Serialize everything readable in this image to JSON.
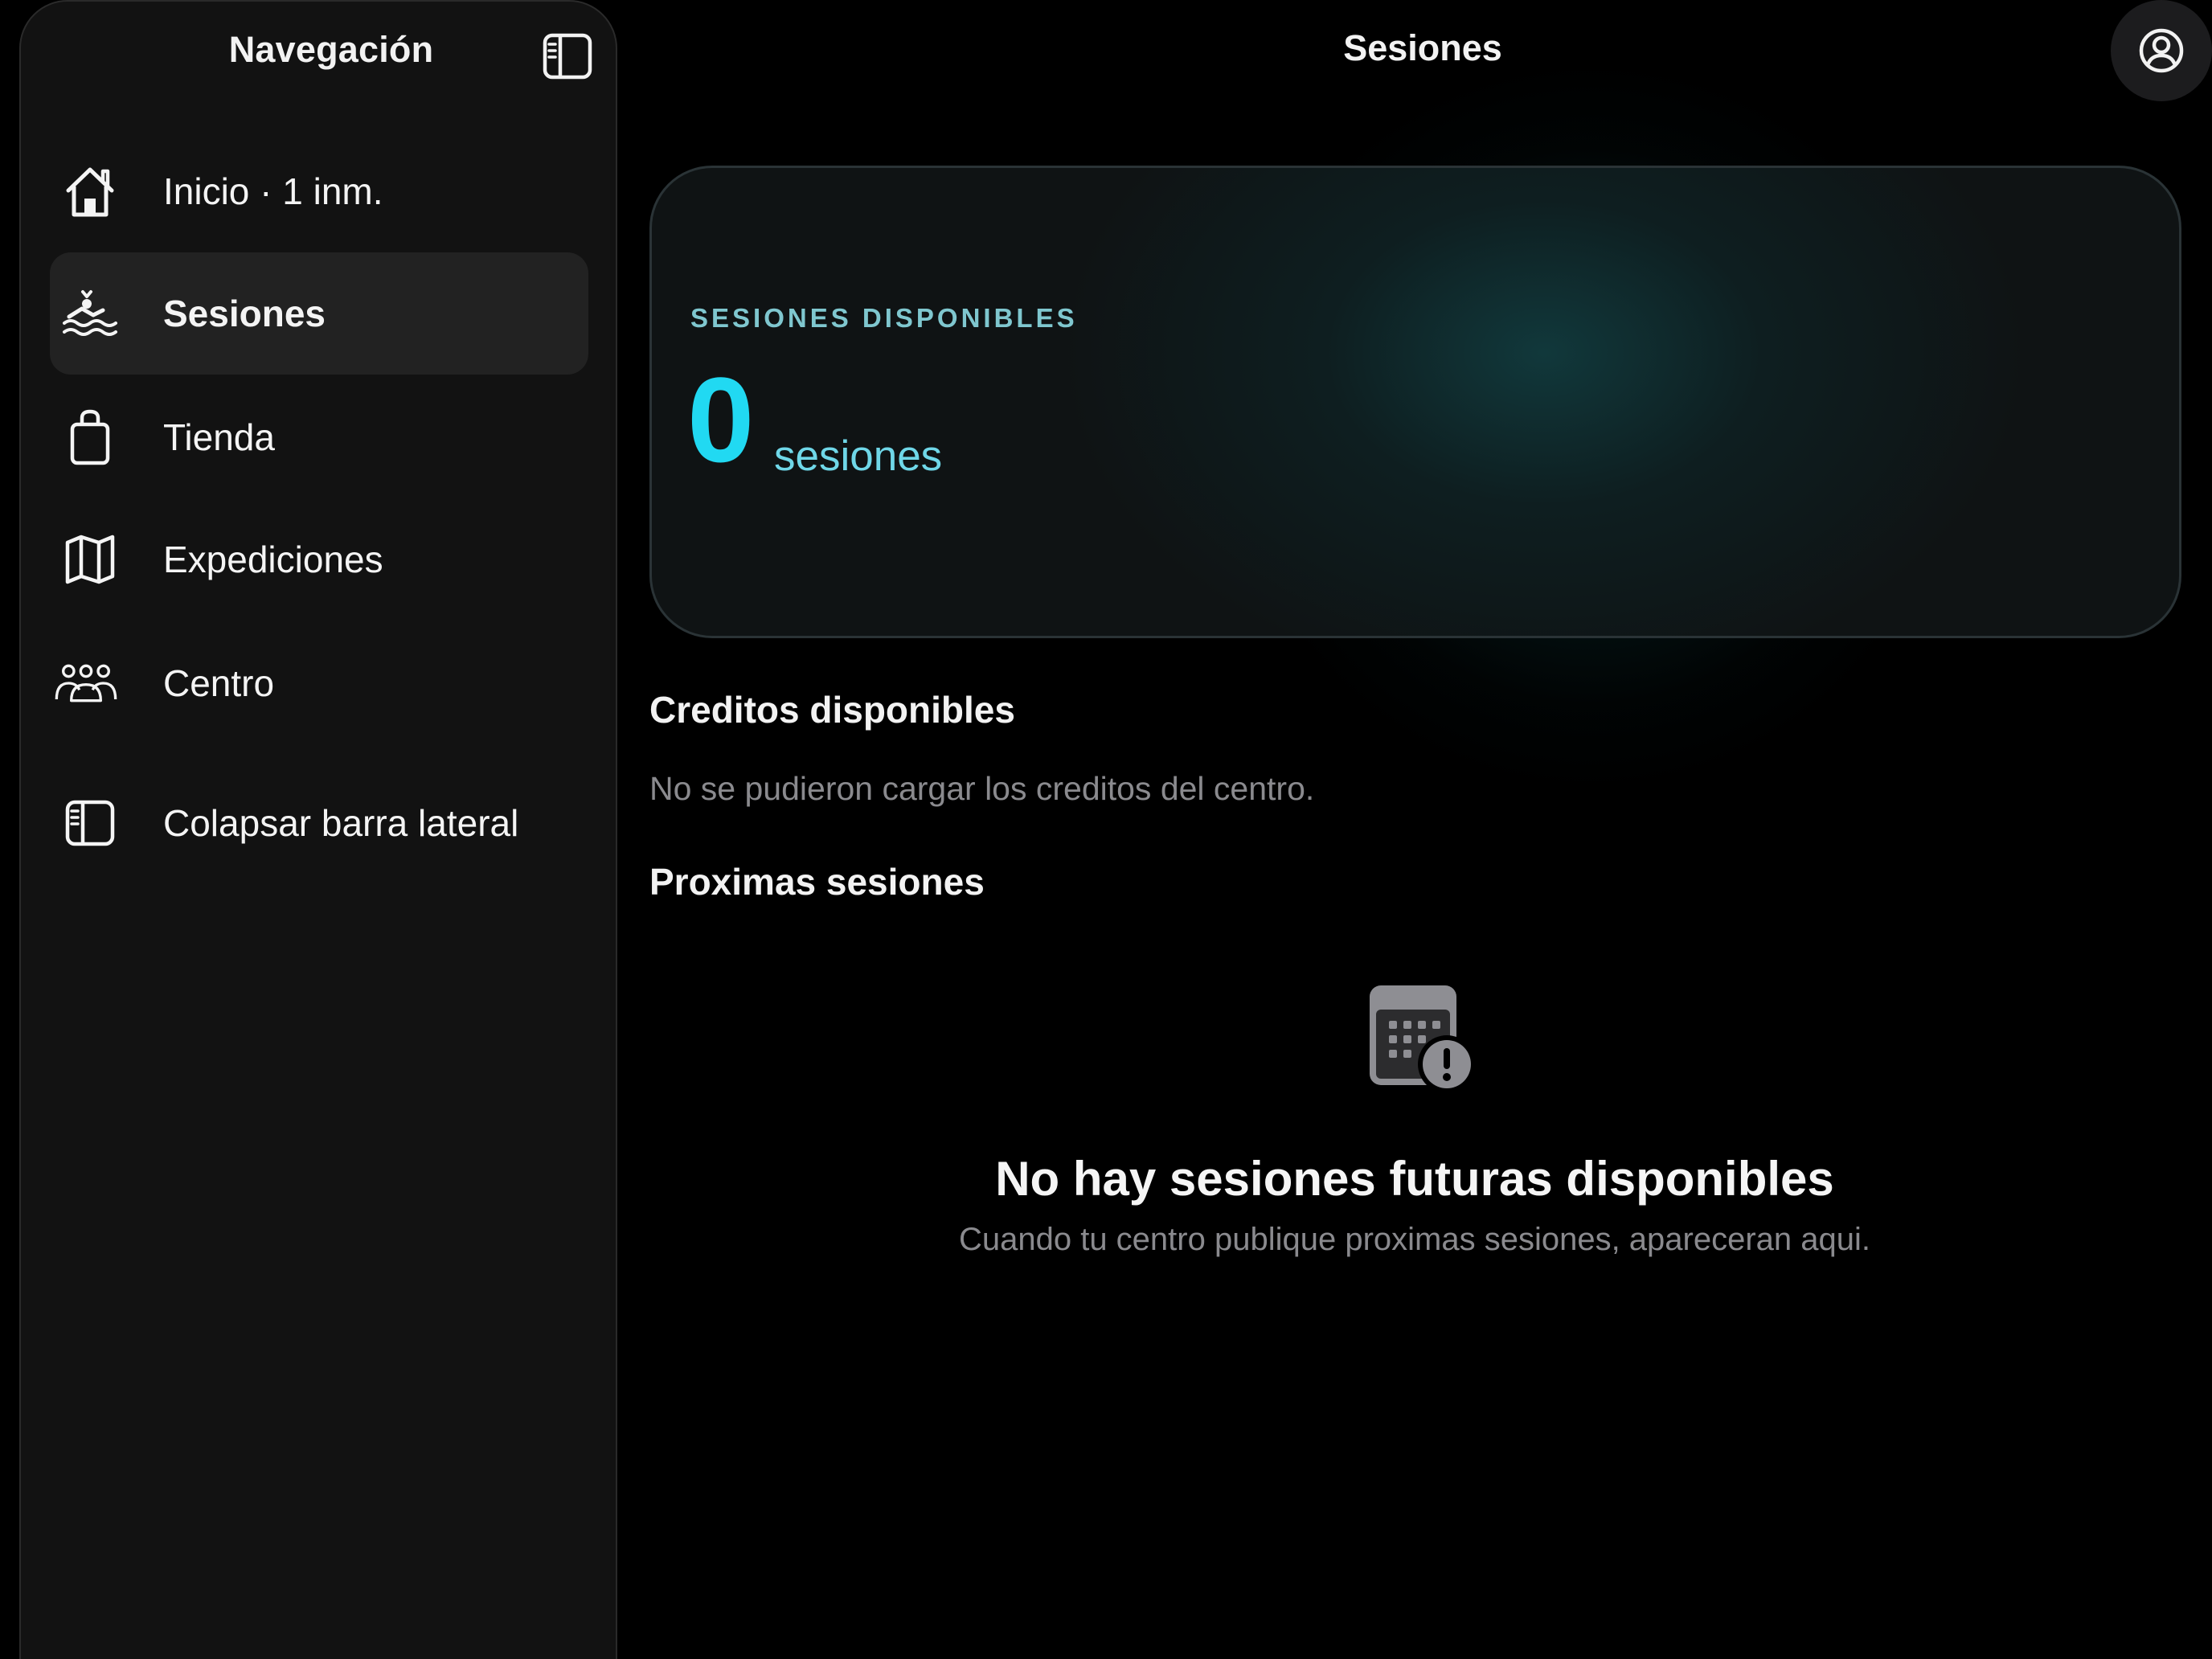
{
  "sidebar": {
    "title": "Navegación",
    "toggle_icon": "sidebar-toggle-icon",
    "items": [
      {
        "label": "Inicio · 1 inm.",
        "icon": "house-icon",
        "selected": false
      },
      {
        "label": "Sesiones",
        "icon": "swimmer-icon",
        "selected": true
      },
      {
        "label": "Tienda",
        "icon": "shopping-bag-icon",
        "selected": false
      },
      {
        "label": "Expediciones",
        "icon": "map-icon",
        "selected": false
      },
      {
        "label": "Centro",
        "icon": "people-icon",
        "selected": false
      },
      {
        "label": "Colapsar barra lateral",
        "icon": "sidebar-left-icon",
        "selected": false
      }
    ]
  },
  "header": {
    "title": "Sesiones",
    "profile_icon": "person-circle-icon"
  },
  "hero": {
    "label": "SESIONES DISPONIBLES",
    "value": "0",
    "unit": "sesiones"
  },
  "credits": {
    "title": "Creditos disponibles",
    "message": "No se pudieron cargar los creditos del centro."
  },
  "upcoming": {
    "title": "Proximas sesiones",
    "empty_icon": "calendar-exclamation-icon",
    "empty_title": "No hay sesiones futuras disponibles",
    "empty_subtitle": "Cuando tu centro publique proximas sesiones, apareceran aqui."
  },
  "colors": {
    "background": "#000000",
    "sidebar": "#121212",
    "selected": "#222222",
    "accent": "#21d9f2",
    "accent_label": "#7fc7cf",
    "muted_text": "#8a8a8e"
  }
}
